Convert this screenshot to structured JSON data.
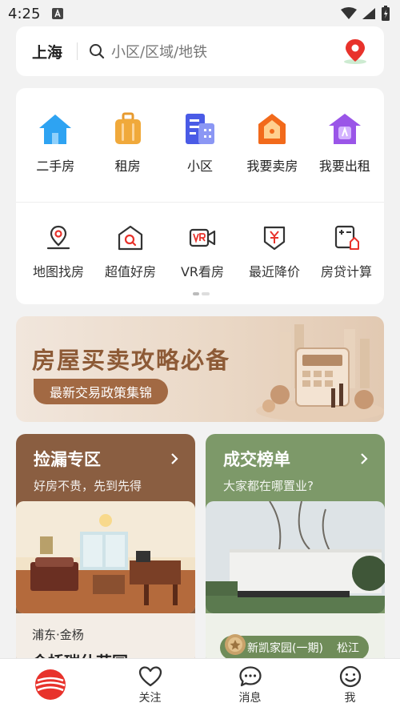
{
  "status": {
    "time": "4:25"
  },
  "search": {
    "city": "上海",
    "placeholder": "小区/区域/地铁"
  },
  "menu_primary": [
    {
      "label": "二手房",
      "icon": "house-icon"
    },
    {
      "label": "租房",
      "icon": "suitcase-icon"
    },
    {
      "label": "小区",
      "icon": "buildings-icon"
    },
    {
      "label": "我要卖房",
      "icon": "sell-house-icon"
    },
    {
      "label": "我要出租",
      "icon": "rent-out-icon"
    }
  ],
  "menu_secondary": [
    {
      "label": "地图找房",
      "icon": "map-pin-icon"
    },
    {
      "label": "超值好房",
      "icon": "value-house-icon"
    },
    {
      "label": "VR看房",
      "icon": "vr-camera-icon"
    },
    {
      "label": "最近降价",
      "icon": "price-drop-icon"
    },
    {
      "label": "房贷计算",
      "icon": "calculator-icon"
    }
  ],
  "banner": {
    "title": "房屋买卖攻略必备",
    "cta": "最新交易政策集锦"
  },
  "card_left": {
    "title": "捡漏专区",
    "subtitle": "好房不贵，先到先得",
    "location": "浦东·金杨",
    "estate": "金桥瑞仕花园"
  },
  "card_right": {
    "title": "成交榜单",
    "subtitle": "大家都在哪置业?",
    "estate": "新凯家园(一期)",
    "district": "松江"
  },
  "tabs": [
    {
      "label": "",
      "icon": "brand-logo-icon"
    },
    {
      "label": "关注",
      "icon": "heart-icon"
    },
    {
      "label": "消息",
      "icon": "message-icon"
    },
    {
      "label": "我",
      "icon": "profile-icon"
    }
  ],
  "colors": {
    "accent": "#e8322b",
    "card_brown": "#8a5e41",
    "card_green": "#7d9969"
  }
}
